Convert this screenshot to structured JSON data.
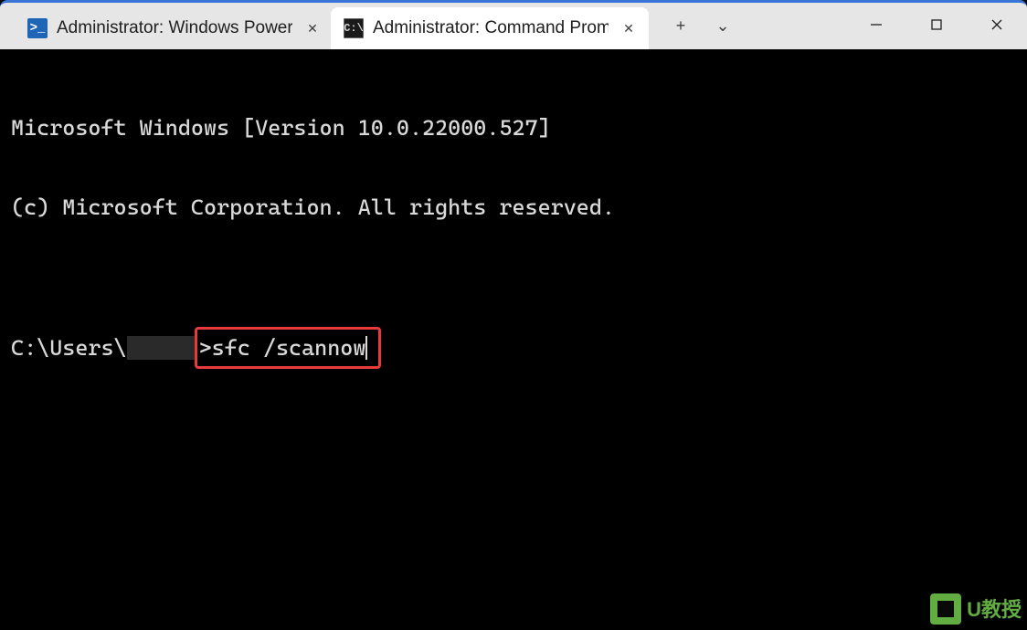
{
  "tabs": [
    {
      "label": "Administrator: Windows PowerS",
      "icon": "powershell-icon",
      "active": false
    },
    {
      "label": "Administrator: Command Promp",
      "icon": "cmd-icon",
      "active": true
    }
  ],
  "terminal": {
    "line1": "Microsoft Windows [Version 10.0.22000.527]",
    "line2": "(c) Microsoft Corporation. All rights reserved.",
    "prompt_prefix": "C:\\Users\\",
    "prompt_suffix": ">",
    "command": "sfc /scannow"
  },
  "icons": {
    "ps_glyph": ">_",
    "cmd_glyph": "C:\\",
    "plus": "+",
    "chevron": "⌄",
    "close_x": "✕"
  },
  "watermark": {
    "text": "U教授",
    "sub": ""
  }
}
